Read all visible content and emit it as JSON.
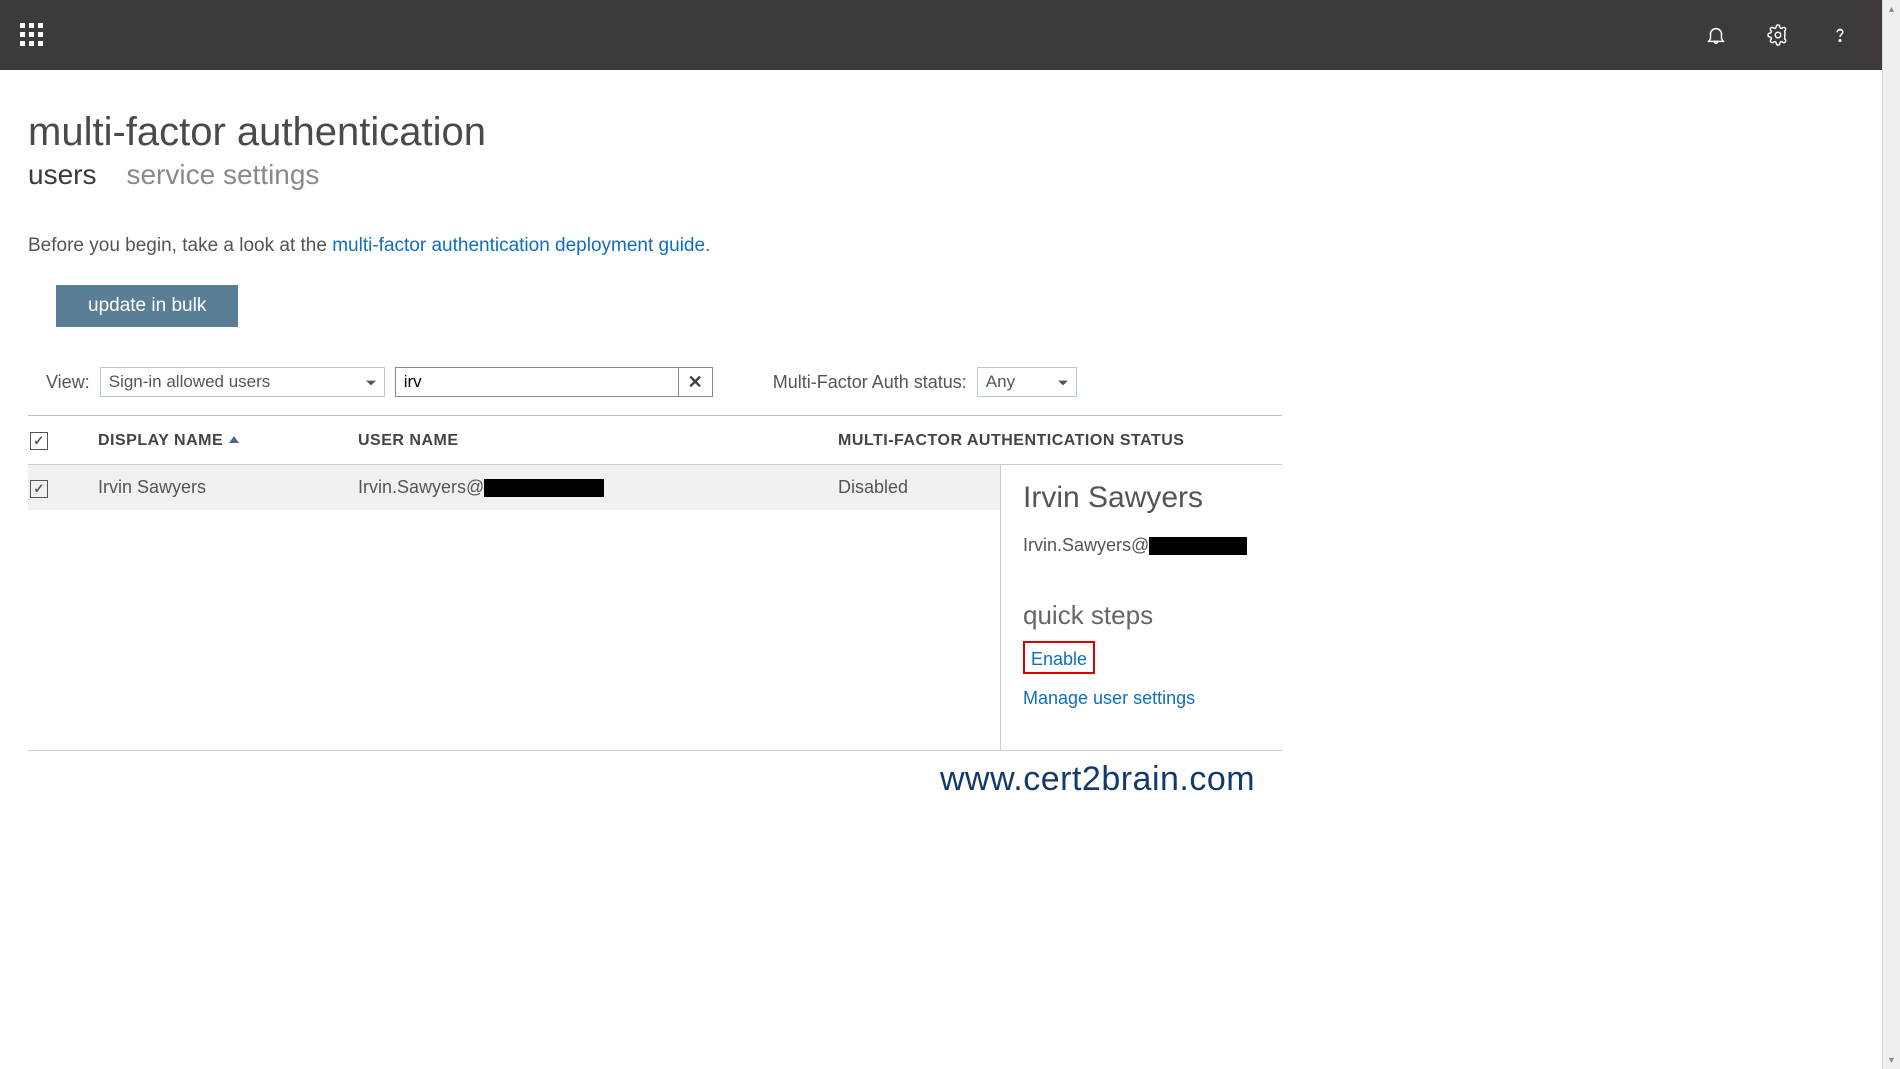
{
  "header": {
    "title": "multi-factor authentication"
  },
  "tabs": {
    "users": "users",
    "service_settings": "service settings"
  },
  "intro": {
    "prefix": "Before you begin, take a look at the ",
    "link": "multi-factor authentication deployment guide",
    "suffix": "."
  },
  "buttons": {
    "bulk": "update in bulk"
  },
  "filters": {
    "view_label": "View:",
    "view_value": "Sign-in allowed users",
    "search_value": "irv",
    "mfa_label": "Multi-Factor Auth status:",
    "mfa_value": "Any"
  },
  "table": {
    "head": {
      "display_name": "DISPLAY NAME",
      "username": "USER NAME",
      "status": "MULTI-FACTOR AUTHENTICATION STATUS"
    },
    "rows": [
      {
        "display_name": "Irvin Sawyers",
        "user_prefix": "Irvin.Sawyers@",
        "status": "Disabled"
      }
    ]
  },
  "details": {
    "name": "Irvin Sawyers",
    "email_prefix": "Irvin.Sawyers@",
    "quick_steps": "quick steps",
    "enable": "Enable",
    "manage": "Manage user settings"
  },
  "watermark": "www.cert2brain.com"
}
